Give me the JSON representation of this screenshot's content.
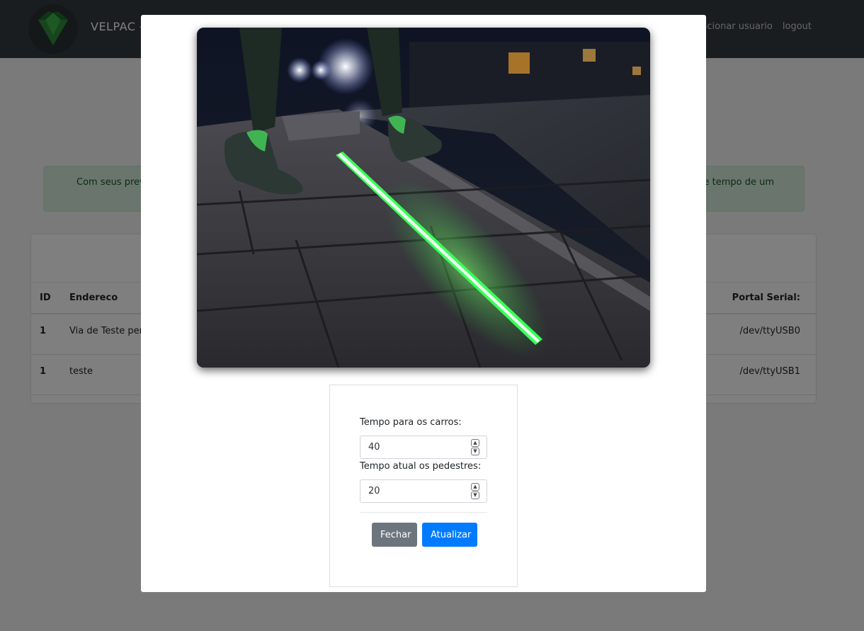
{
  "navbar": {
    "brand": "VELPAC -",
    "links": [
      "dicionar usuario",
      "logout"
    ]
  },
  "alert": {
    "text_left": "Com seus previl",
    "text_right": "de tempo de um"
  },
  "table": {
    "headers": {
      "id": "ID",
      "address": "Endereco",
      "serial": "Portal Serial:"
    },
    "rows": [
      {
        "id": "1",
        "address": "Via de Teste perto",
        "serial": "/dev/ttyUSB0"
      },
      {
        "id": "1",
        "address": "teste",
        "serial": "/dev/ttyUSB1"
      }
    ]
  },
  "modal": {
    "photo_alt": "pedestrian-crossing-led-strip",
    "fields": [
      {
        "label": "Tempo para os carros:",
        "value": "40"
      },
      {
        "label": "Tempo atual os pedestres:",
        "value": "20"
      }
    ],
    "buttons": {
      "close": "Fechar",
      "update": "Atualizar"
    }
  },
  "colors": {
    "navbar": "#343a40",
    "primary": "#007bff",
    "secondary": "#6c757d",
    "alert_bg": "#d4edda",
    "led_green": "#39ff5a"
  }
}
